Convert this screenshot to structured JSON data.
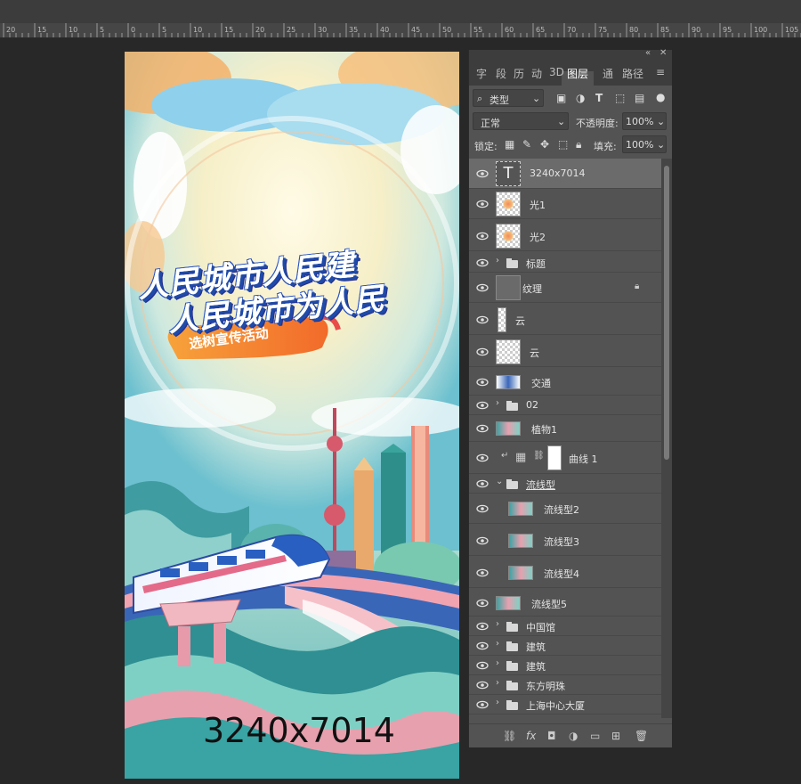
{
  "ruler": {
    "labels": [
      "20",
      "15",
      "10",
      "5",
      "0",
      "5",
      "10",
      "15",
      "20",
      "25",
      "30",
      "35",
      "40",
      "45",
      "50",
      "55",
      "60",
      "65",
      "70",
      "75",
      "80",
      "85",
      "90",
      "95",
      "100",
      "105"
    ]
  },
  "canvas": {
    "headline_line1": "人民城市人民建",
    "headline_line2": "人民城市为人民",
    "subtitle": "选树宣传活动",
    "size_label": "3240x7014"
  },
  "panel": {
    "tabs": [
      {
        "label": "字"
      },
      {
        "label": "段"
      },
      {
        "label": "历"
      },
      {
        "label": "动"
      },
      {
        "label": "3D"
      },
      {
        "label": "图层",
        "active": true
      },
      {
        "label": "通"
      },
      {
        "label": "路径"
      }
    ],
    "filter_kind": "类型",
    "blend_mode": "正常",
    "opacity_label": "不透明度:",
    "opacity_value": "100%",
    "lock_label": "锁定:",
    "fill_label": "填充:",
    "fill_value": "100%"
  },
  "layers": [
    {
      "name": "3240x7014",
      "kind": "text",
      "selected": true
    },
    {
      "name": "光1",
      "kind": "layer",
      "thumb": "light"
    },
    {
      "name": "光2",
      "kind": "layer",
      "thumb": "light"
    },
    {
      "name": "标题",
      "kind": "group",
      "collapsed": true
    },
    {
      "name": "纹理",
      "kind": "layer",
      "thumb": "texture",
      "locked": true
    },
    {
      "name": "云",
      "kind": "layer",
      "thumb": "cloud-narrow"
    },
    {
      "name": "云",
      "kind": "layer",
      "thumb": "checker"
    },
    {
      "name": "交通",
      "kind": "layer",
      "thumb": "traffic"
    },
    {
      "name": "02",
      "kind": "group",
      "collapsed": true
    },
    {
      "name": "植物1",
      "kind": "layer",
      "thumb": "plant"
    },
    {
      "name": "曲线 1",
      "kind": "adjustment"
    },
    {
      "name": "流线型",
      "kind": "group",
      "collapsed": false
    },
    {
      "name": "流线型2",
      "kind": "layer",
      "thumb": "stream",
      "indent": true
    },
    {
      "name": "流线型3",
      "kind": "layer",
      "thumb": "stream",
      "indent": true
    },
    {
      "name": "流线型4",
      "kind": "layer",
      "thumb": "stream",
      "indent": true
    },
    {
      "name": "流线型5",
      "kind": "layer",
      "thumb": "stream5"
    },
    {
      "name": "中国馆",
      "kind": "group",
      "collapsed": true
    },
    {
      "name": "建筑",
      "kind": "group",
      "collapsed": true
    },
    {
      "name": "建筑",
      "kind": "group",
      "collapsed": true
    },
    {
      "name": "东方明珠",
      "kind": "group",
      "collapsed": true
    },
    {
      "name": "上海中心大厦",
      "kind": "group",
      "collapsed": true
    }
  ],
  "bottom_icons": [
    "link-icon",
    "fx-icon",
    "mask-icon",
    "adjustment-icon",
    "folder-icon",
    "new-layer-icon",
    "trash-icon"
  ],
  "colors": {
    "panel": "#535353",
    "selected": "#6b6b6b",
    "canvas_bg": "#282828"
  }
}
